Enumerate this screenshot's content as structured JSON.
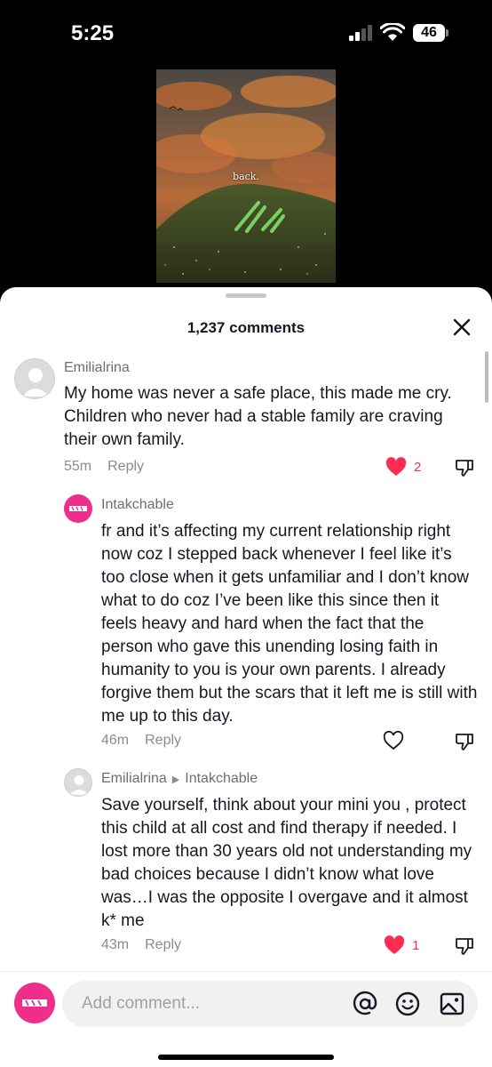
{
  "status_bar": {
    "time": "5:25",
    "battery": "46"
  },
  "video": {
    "caption": "back."
  },
  "comments_sheet": {
    "title": "1,237 comments",
    "comments": [
      {
        "username": "Emilialrina",
        "text": "My home was never a safe place, this made me cry. Children who never had a stable family are craving their own family.",
        "age": "55m",
        "reply_label": "Reply",
        "likes": "2",
        "liked": true
      }
    ],
    "replies": [
      {
        "username": "Intakchable",
        "text": "fr and it’s affecting my current relationship right now coz I stepped back whenever I feel like it’s too close when it gets unfamiliar and I don’t know what to do coz I’ve been like this since then it feels heavy and hard when the fact that the person who gave this unending losing faith in humanity to you is your own parents. I already forgive them but the scars that it left me is still with me up to this day.",
        "age": "46m",
        "reply_label": "Reply",
        "liked": false
      },
      {
        "username": "Emilialrina",
        "reply_to": "Intakchable",
        "text": "Save yourself, think about your mini you , protect this child at all cost and find therapy if needed. I lost more than 30 years old not understanding my bad choices because I didn’t know what love was…I was the opposite I overgave and it almost k* me",
        "age": "43m",
        "reply_label": "Reply",
        "likes": "1",
        "liked": true
      }
    ]
  },
  "composer": {
    "placeholder": "Add comment..."
  },
  "colors": {
    "like_red": "#fe2c55",
    "brand_pink": "#ee2e8a",
    "text": "#161823",
    "meta": "#8a8b91"
  },
  "icons": [
    "signal-icon",
    "wifi-icon",
    "close-icon",
    "heart-icon",
    "thumbs-down-icon",
    "mention-icon",
    "emoji-icon",
    "image-icon"
  ]
}
